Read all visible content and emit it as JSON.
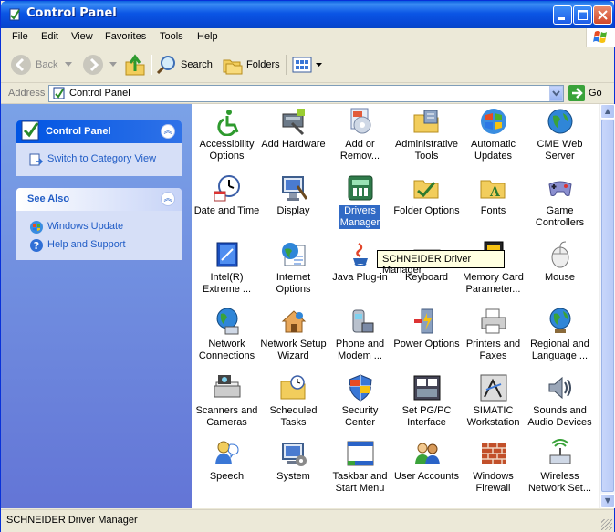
{
  "window": {
    "title": "Control Panel"
  },
  "menu": [
    "File",
    "Edit",
    "View",
    "Favorites",
    "Tools",
    "Help"
  ],
  "toolbar": {
    "back": "Back",
    "search": "Search",
    "folders": "Folders"
  },
  "address": {
    "label": "Address",
    "value": "Control Panel",
    "go": "Go"
  },
  "sidebar": {
    "control_panel": {
      "title": "Control Panel",
      "links": [
        "Switch to Category View"
      ]
    },
    "see_also": {
      "title": "See Also",
      "links": [
        "Windows Update",
        "Help and Support"
      ]
    }
  },
  "items": [
    {
      "label": "Accessibility Options",
      "lines": [
        "Accessibility",
        "Options"
      ],
      "icon": "accessibility-icon"
    },
    {
      "label": "Add Hardware",
      "lines": [
        "Add Hardware"
      ],
      "icon": "add-hardware-icon"
    },
    {
      "label": "Add or Remove Programs",
      "lines": [
        "Add or",
        "Remov..."
      ],
      "icon": "add-remove-programs-icon"
    },
    {
      "label": "Administrative Tools",
      "lines": [
        "Administrative",
        "Tools"
      ],
      "icon": "administrative-tools-icon"
    },
    {
      "label": "Automatic Updates",
      "lines": [
        "Automatic",
        "Updates"
      ],
      "icon": "automatic-updates-icon"
    },
    {
      "label": "CME Web Server",
      "lines": [
        "CME Web",
        "Server"
      ],
      "icon": "cme-web-server-icon"
    },
    {
      "label": "Date and Time",
      "lines": [
        "Date and Time"
      ],
      "icon": "clock-icon"
    },
    {
      "label": "Display",
      "lines": [
        "Display"
      ],
      "icon": "display-icon"
    },
    {
      "label": "Drivers Manager",
      "lines": [
        "Drivers",
        "Manager"
      ],
      "icon": "drivers-manager-icon",
      "selected": true
    },
    {
      "label": "Folder Options",
      "lines": [
        "Folder Options"
      ],
      "icon": "folder-options-icon"
    },
    {
      "label": "Fonts",
      "lines": [
        "Fonts"
      ],
      "icon": "fonts-folder-icon"
    },
    {
      "label": "Game Controllers",
      "lines": [
        "Game",
        "Controllers"
      ],
      "icon": "game-controller-icon"
    },
    {
      "label": "Intel(R) Extreme Graphics",
      "lines": [
        "Intel(R)",
        "Extreme ..."
      ],
      "icon": "intel-graphics-icon"
    },
    {
      "label": "Internet Options",
      "lines": [
        "Internet",
        "Options"
      ],
      "icon": "internet-options-icon"
    },
    {
      "label": "Java Plug-in",
      "lines": [
        "Java Plug-in"
      ],
      "icon": "java-icon"
    },
    {
      "label": "Keyboard",
      "lines": [
        "Keyboard"
      ],
      "icon": "keyboard-icon"
    },
    {
      "label": "Memory Card Parameter",
      "lines": [
        "Memory Card",
        "Parameter..."
      ],
      "icon": "memory-card-icon"
    },
    {
      "label": "Mouse",
      "lines": [
        "Mouse"
      ],
      "icon": "mouse-icon"
    },
    {
      "label": "Network Connections",
      "lines": [
        "Network",
        "Connections"
      ],
      "icon": "network-connections-icon"
    },
    {
      "label": "Network Setup Wizard",
      "lines": [
        "Network Setup",
        "Wizard"
      ],
      "icon": "network-setup-icon"
    },
    {
      "label": "Phone and Modem",
      "lines": [
        "Phone and",
        "Modem ..."
      ],
      "icon": "phone-modem-icon"
    },
    {
      "label": "Power Options",
      "lines": [
        "Power Options"
      ],
      "icon": "power-options-icon"
    },
    {
      "label": "Printers and Faxes",
      "lines": [
        "Printers and",
        "Faxes"
      ],
      "icon": "printer-icon"
    },
    {
      "label": "Regional and Language",
      "lines": [
        "Regional and",
        "Language ..."
      ],
      "icon": "globe-icon"
    },
    {
      "label": "Scanners and Cameras",
      "lines": [
        "Scanners and",
        "Cameras"
      ],
      "icon": "scanner-icon"
    },
    {
      "label": "Scheduled Tasks",
      "lines": [
        "Scheduled",
        "Tasks"
      ],
      "icon": "scheduled-tasks-icon"
    },
    {
      "label": "Security Center",
      "lines": [
        "Security",
        "Center"
      ],
      "icon": "shield-icon"
    },
    {
      "label": "Set PG/PC Interface",
      "lines": [
        "Set PG/PC",
        "Interface"
      ],
      "icon": "pgpc-interface-icon"
    },
    {
      "label": "SIMATIC Workstation",
      "lines": [
        "SIMATIC",
        "Workstation"
      ],
      "icon": "simatic-icon"
    },
    {
      "label": "Sounds and Audio Devices",
      "lines": [
        "Sounds and",
        "Audio Devices"
      ],
      "icon": "speaker-icon"
    },
    {
      "label": "Speech",
      "lines": [
        "Speech"
      ],
      "icon": "speech-icon"
    },
    {
      "label": "System",
      "lines": [
        "System"
      ],
      "icon": "system-icon"
    },
    {
      "label": "Taskbar and Start Menu",
      "lines": [
        "Taskbar and",
        "Start Menu"
      ],
      "icon": "taskbar-icon"
    },
    {
      "label": "User Accounts",
      "lines": [
        "User Accounts"
      ],
      "icon": "user-accounts-icon"
    },
    {
      "label": "Windows Firewall",
      "lines": [
        "Windows",
        "Firewall"
      ],
      "icon": "firewall-icon"
    },
    {
      "label": "Wireless Network Setup",
      "lines": [
        "Wireless",
        "Network Set..."
      ],
      "icon": "wireless-icon"
    }
  ],
  "tooltip": "SCHNEIDER Driver Manager",
  "status": "SCHNEIDER Driver Manager"
}
